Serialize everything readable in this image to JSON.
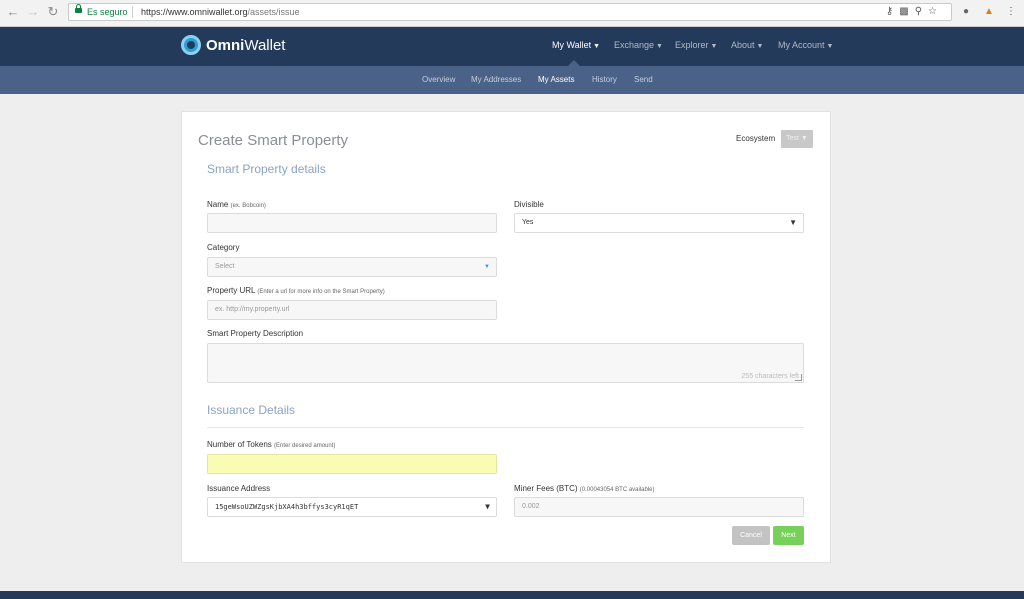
{
  "browser": {
    "secure_label": "Es seguro",
    "url_host": "https://www.omniwallet.org",
    "url_path": "/assets/issue"
  },
  "brand": {
    "name_bold": "Omni",
    "name_rest": "Wallet"
  },
  "top_nav": [
    {
      "label": "My Wallet",
      "active": true
    },
    {
      "label": "Exchange"
    },
    {
      "label": "Explorer"
    },
    {
      "label": "About"
    },
    {
      "label": "My Account"
    }
  ],
  "sub_nav": [
    {
      "label": "Overview"
    },
    {
      "label": "My Addresses"
    },
    {
      "label": "My Assets",
      "active": true
    },
    {
      "label": "History"
    },
    {
      "label": "Send"
    }
  ],
  "form": {
    "title": "Create Smart Property",
    "ecosystem_label": "Ecosystem",
    "ecosystem_value": "Test",
    "details_heading": "Smart Property details",
    "name_label": "Name",
    "name_hint": "(ex. Bobcoin)",
    "divisible_label": "Divisible",
    "divisible_value": "Yes",
    "category_label": "Category",
    "category_value": "Select",
    "url_label": "Property URL",
    "url_hint": "(Enter a url for more info on the Smart Property)",
    "url_placeholder": "ex. http://my.property.url",
    "description_label": "Smart Property Description",
    "chars_left": "255 characters left",
    "issuance_heading": "Issuance Details",
    "tokens_label": "Number of Tokens",
    "tokens_hint": "(Enter desired amount)",
    "address_label": "Issuance Address",
    "address_value": "15geWsoUZWZgsKjbXA4h3bffys3cyR1qET",
    "fees_label": "Miner Fees (BTC)",
    "fees_hint": "(0.00043054 BTC available)",
    "fees_value": "0.002",
    "cancel_label": "Cancel",
    "next_label": "Next"
  },
  "colors": {
    "header_bg": "#243a5a",
    "subnav_bg": "#4a6287",
    "next_button": "#76d15a",
    "cancel_button": "#c3c3c3",
    "tokens_field": "#fafcb5"
  }
}
